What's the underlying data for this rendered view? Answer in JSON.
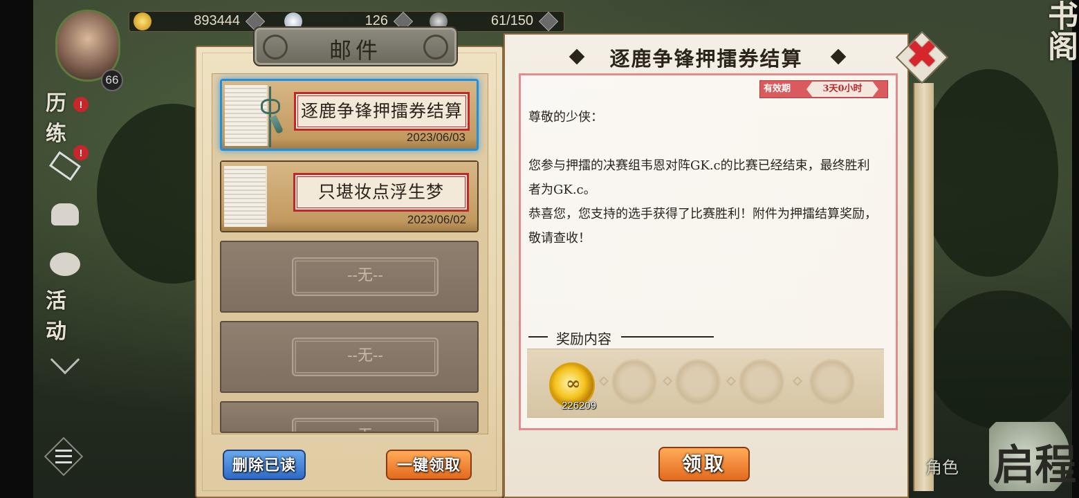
{
  "resources": [
    {
      "icon": "gold-coins-icon",
      "value": "893444"
    },
    {
      "icon": "star-shard-icon",
      "value": "126"
    },
    {
      "icon": "stamina-icon",
      "value": "61/150"
    }
  ],
  "player": {
    "level": "66"
  },
  "sidebar": {
    "items": [
      {
        "label": "历练",
        "icon": "training-icon",
        "badge": "!"
      },
      {
        "label": "",
        "icon": "ticket-icon",
        "badge": "!"
      },
      {
        "label": "",
        "icon": "friends-icon",
        "badge": ""
      },
      {
        "label": "",
        "icon": "chat-icon",
        "badge": ""
      },
      {
        "label": "活动",
        "icon": "event-icon",
        "badge": ""
      },
      {
        "label": "",
        "icon": "collapse-icon",
        "badge": ""
      }
    ]
  },
  "right_corner": {
    "tab_label": "书阁",
    "journey_label": "启程",
    "role_label": "角色"
  },
  "mail": {
    "title": "邮件",
    "items": [
      {
        "subject": "逐鹿争锋押擂券结算",
        "date": "2023/06/03",
        "selected": true
      },
      {
        "subject": "只堪妆点浮生梦",
        "date": "2023/06/02",
        "selected": false
      }
    ],
    "empty_label": "--无--",
    "delete_read_label": "删除已读",
    "collect_all_label": "一键领取"
  },
  "detail": {
    "title": "逐鹿争锋押擂券结算",
    "validity_label": "有效期",
    "validity_value": "3天0小时",
    "greeting": "尊敬的少侠：",
    "body1": "您参与押擂的决赛组韦恩对阵GK.c的比赛已经结束，最终胜利者为GK.c。",
    "body2": "恭喜您，您支持的选手获得了比赛胜利！附件为押擂结算奖励，敬请查收！",
    "reward_heading": "奖励内容",
    "rewards": [
      {
        "icon": "gold-coins-icon",
        "quantity": "226209"
      }
    ],
    "claim_label": "领取"
  },
  "colors": {
    "selected_border": "#1e8fe0",
    "label_border": "#c0262a",
    "close_red": "#d7262b",
    "claim_orange": "#e36a1e",
    "delete_blue": "#2f6bc4"
  }
}
